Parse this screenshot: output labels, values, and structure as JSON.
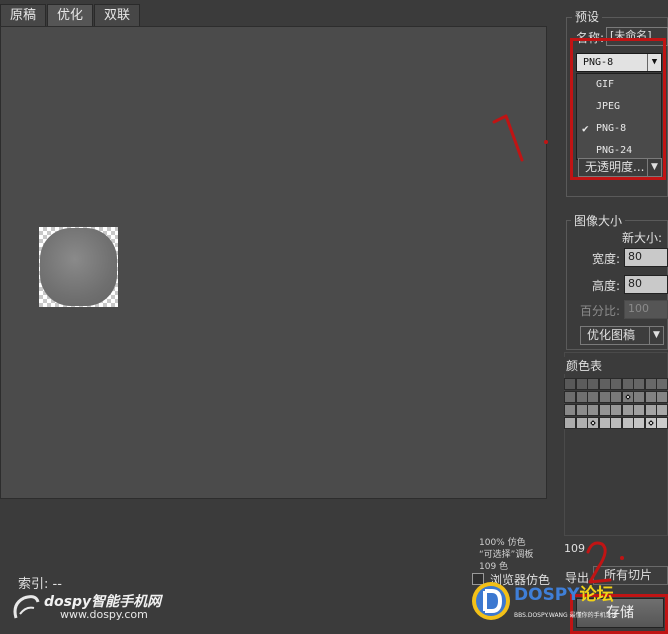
{
  "tabs": [
    "原稿",
    "优化",
    "双联"
  ],
  "info_lines": [
    "100% 仿色",
    "“可选择”调板",
    "109 色"
  ],
  "index_label": "索引: --",
  "preset_group": {
    "title": "预设",
    "name_label": "名称:",
    "name_value": "[未命名]",
    "format_value": "PNG-8",
    "format_options": [
      "GIF",
      "JPEG",
      "PNG-8",
      "PNG-24"
    ],
    "checked_option": "PNG-8",
    "transparency_dither": "无透明度..."
  },
  "image_size_group": {
    "title": "图像大小",
    "new_size_label": "新大小:",
    "width_label": "宽度:",
    "width_value": "80",
    "height_label": "高度:",
    "height_value": "80",
    "percent_label": "百分比:",
    "percent_value": "100",
    "quality_value": "优化图稿"
  },
  "color_table": {
    "title": "颜色表",
    "count": "109",
    "rows": [
      [
        "#595959",
        "#5c5c5c",
        "#5e5e5e",
        "#606060",
        "#626262",
        "#646464",
        "#666666",
        "#686868",
        "#6a6a6a"
      ],
      [
        "#6d6d6d",
        "#707070",
        "#737373",
        "#767676",
        "#797979",
        "#7c7c7c",
        "#7f7f7f",
        "#828282",
        "#858585"
      ],
      [
        "#888888",
        "#8c8c8c",
        "#909090",
        "#949494",
        "#989898",
        "#9c9c9c",
        "#a0a0a0",
        "#a4a4a4",
        "#a8a8a8"
      ],
      [
        "#acacac",
        "#b0b0b0",
        "#b4b4b4",
        "#b8b8b8",
        "#bcbcbc",
        "#c0c0c0",
        "#c4c4c4",
        "#c8c8c8",
        "#cccccc"
      ]
    ]
  },
  "bottom": {
    "browser_dither_label": "浏览器仿色",
    "export_label": "导出",
    "slices_value": "所有切片",
    "save_label": "存储"
  },
  "annotations": {
    "step1": "1",
    "step2": "2"
  },
  "watermarks": {
    "left_brand": "dospy智能手机网",
    "left_url": "www.dospy.com",
    "right_brand_a": "DOSPY",
    "right_brand_b": "论坛",
    "right_sub": "BBS.DOSPY.WANG 最懂你的手机论坛"
  }
}
